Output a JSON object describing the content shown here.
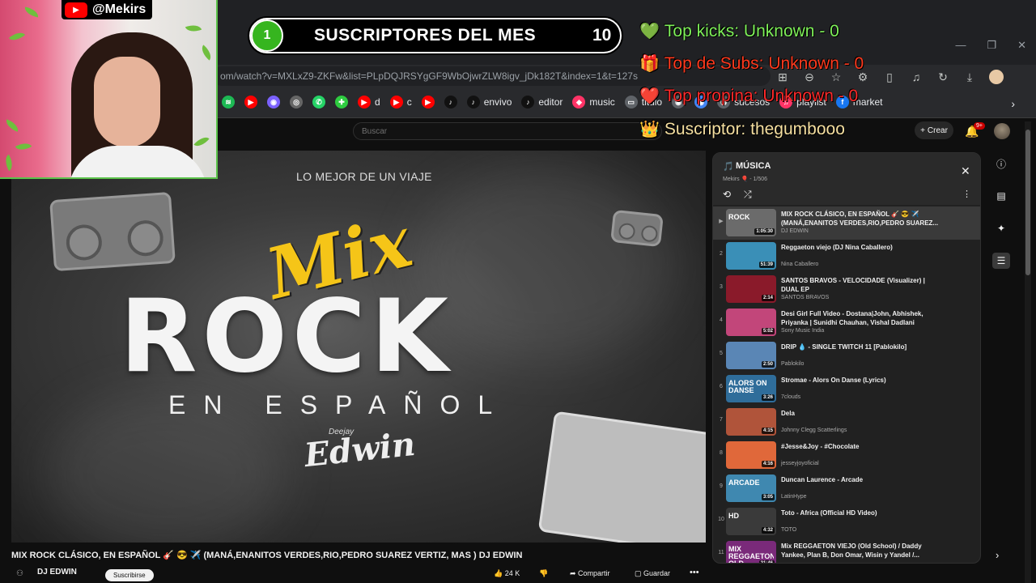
{
  "browser": {
    "url": "om/watch?v=MXLxZ9-ZKFw&list=PLpDQJRSYgGF9WbOjwrZLW8igv_jDk182T&index=1&t=127s",
    "bookmarks": [
      {
        "label": "",
        "icon": "spotify-icon",
        "color": "#1db954"
      },
      {
        "label": "",
        "icon": "youtube-icon",
        "color": "#ff0000"
      },
      {
        "label": "",
        "icon": "app-icon",
        "color": "#7b61ff"
      },
      {
        "label": "",
        "icon": "instagram-icon",
        "color": "#666666"
      },
      {
        "label": "",
        "icon": "whatsapp-icon",
        "color": "#25d366"
      },
      {
        "label": "",
        "icon": "puzzle-icon",
        "color": "#2ecc40"
      },
      {
        "label": "d",
        "icon": "youtube-icon",
        "color": "#ff0000"
      },
      {
        "label": "c",
        "icon": "youtube-icon",
        "color": "#ff0000"
      },
      {
        "label": "",
        "icon": "youtube-icon",
        "color": "#ff0000"
      },
      {
        "label": "",
        "icon": "tiktok-icon",
        "color": "#111111"
      },
      {
        "label": "envivo",
        "icon": "tiktok-icon",
        "color": "#111111"
      },
      {
        "label": "editor",
        "icon": "tiktok-icon",
        "color": "#111111"
      },
      {
        "label": "music",
        "icon": "diamond-icon",
        "color": "#ff3366"
      },
      {
        "label": "titulo",
        "icon": "folder-icon",
        "color": "#5f6368"
      },
      {
        "label": "",
        "icon": "app-icon",
        "color": "#5f6368"
      },
      {
        "label": "",
        "icon": "app-icon",
        "color": "#4285f4"
      },
      {
        "label": "sucesos",
        "icon": "globe-icon",
        "color": "#5f6368"
      },
      {
        "label": "playlist",
        "icon": "music-icon",
        "color": "#ff3366"
      },
      {
        "label": "market",
        "icon": "facebook-icon",
        "color": "#1877f2"
      }
    ]
  },
  "youtube": {
    "search_placeholder": "Buscar",
    "create_label": "Crear",
    "notification_count": "9+"
  },
  "video": {
    "overlay_subtitle": "LO MEJOR DE UN VIAJE",
    "overlay_mix": "Mix",
    "overlay_rock": "ROCK",
    "overlay_espanol": "EN ESPAÑOL",
    "overlay_deejay": "Deejay",
    "overlay_edwin": "Edwin",
    "title": "MIX ROCK CLÁSICO, EN ESPAÑOL 🎸 😎 ✈️ (MANÁ,ENANITOS VERDES,RIO,PEDRO SUAREZ VERTIZ, MAS ) DJ EDWIN",
    "channel": "DJ EDWIN",
    "subscribe_label": "Suscribirse",
    "likes": "24 K",
    "share_label": "Compartir",
    "save_label": "Guardar"
  },
  "playlist": {
    "title": "MÚSICA",
    "subtitle": "Mekirs 🎈 - 1/506",
    "items": [
      {
        "idx": "▶",
        "title": "MIX ROCK CLÁSICO, EN ESPAÑOL 🎸 😎 ✈️ (MANÁ,ENANITOS VERDES,RIO,PEDRO SUAREZ...",
        "channel": "DJ EDWIN",
        "duration": "1:05:30",
        "thumb_color": "#6b6b6b",
        "thumb_text": "ROCK",
        "active": true
      },
      {
        "idx": "2",
        "title": "Reggaeton viejo (DJ Nina Caballero)",
        "channel": "Nina Caballero",
        "duration": "51:39",
        "thumb_color": "#3a8fb7",
        "thumb_text": "",
        "active": false
      },
      {
        "idx": "3",
        "title": "SANTOS BRAVOS - VELOCIDADE (Visualizer) | DUAL EP",
        "channel": "SANTOS BRAVOS",
        "duration": "2:14",
        "thumb_color": "#8a1a2a",
        "thumb_text": "",
        "active": false
      },
      {
        "idx": "4",
        "title": "Desi Girl Full Video - Dostana|John, Abhishek, Priyanka | Sunidhi Chauhan, Vishal Dadlani",
        "channel": "Sony Music India",
        "duration": "5:02",
        "thumb_color": "#c2467a",
        "thumb_text": "",
        "active": false
      },
      {
        "idx": "5",
        "title": "DRIP 💧 - SINGLE TWITCH 11 [Pablokilo]",
        "channel": "Pablokilo",
        "duration": "2:50",
        "thumb_color": "#5a86b5",
        "thumb_text": "",
        "active": false
      },
      {
        "idx": "6",
        "title": "Stromae - Alors On Danse (Lyrics)",
        "channel": "7clouds",
        "duration": "3:26",
        "thumb_color": "#2f6d9a",
        "thumb_text": "ALORS ON DANSE",
        "active": false
      },
      {
        "idx": "7",
        "title": "Dela",
        "channel": "Johnny Clegg Scatterlings",
        "duration": "4:15",
        "thumb_color": "#b0543a",
        "thumb_text": "",
        "active": false
      },
      {
        "idx": "8",
        "title": "#Jesse&Joy - #Chocolate",
        "channel": "jesseyjoyoficial",
        "duration": "4:16",
        "thumb_color": "#e0683a",
        "thumb_text": "",
        "active": false
      },
      {
        "idx": "9",
        "title": "Duncan Laurence - Arcade",
        "channel": "LatinHype",
        "duration": "3:05",
        "thumb_color": "#3f88b0",
        "thumb_text": "ARCADE",
        "active": false
      },
      {
        "idx": "10",
        "title": "Toto - Africa (Official HD Video)",
        "channel": "TOTO",
        "duration": "4:32",
        "thumb_color": "#3a3a3a",
        "thumb_text": "HD",
        "active": false
      },
      {
        "idx": "11",
        "title": "Mix REGGAETON VIEJO (Old School) / Daddy Yankee, Plan B, Don Omar, Wisin y Yandel /...",
        "channel": "",
        "duration": "21:46",
        "thumb_color": "#7a2a7a",
        "thumb_text": "MIX REGGAETON OLD SCHOOL",
        "active": false
      }
    ]
  },
  "stream": {
    "handle": "@Mekirs",
    "subs_rank": "1",
    "subs_label": "SUSCRIPTORES DEL MES",
    "subs_count": "10",
    "top_kicks": "Top kicks: Unknown - 0",
    "top_subs": "Top de Subs: Unknown - 0",
    "top_tips": "Top propina: Unknown - 0",
    "latest_sub": "Suscriptor: thegumbooo",
    "colors": {
      "accent_green": "#36b51f",
      "kicks": "#7ff05a",
      "subs": "#ff3a1e",
      "tips": "#ff2a2a",
      "sub": "#f5dfa0"
    }
  }
}
